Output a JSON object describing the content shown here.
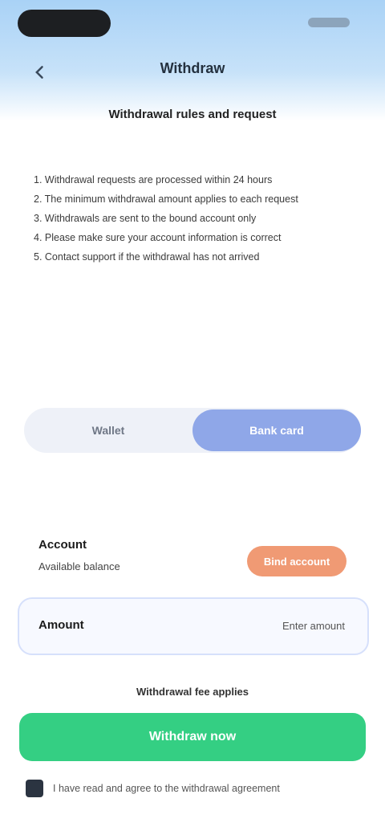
{
  "status_bar": {},
  "header": {
    "title": "Withdraw"
  },
  "intro": "Withdrawal rules and request",
  "rules": [
    "1. Withdrawal requests are processed within 24 hours",
    "2. The minimum withdrawal amount applies to each request",
    "3. Withdrawals are sent to the bound account only",
    "4. Please make sure your account information is correct",
    "5. Contact support if the withdrawal has not arrived"
  ],
  "toggle": {
    "left": "Wallet",
    "right": "Bank card"
  },
  "wallet": {
    "label": "Account",
    "sub": "Available balance",
    "button": "Bind account"
  },
  "amount": {
    "label": "Amount",
    "value": "Enter amount"
  },
  "hint": "Withdrawal fee applies",
  "submit": "Withdraw now",
  "agreement": "I have read and agree to the withdrawal agreement",
  "colors": {
    "header": "#a9d2f6",
    "accent": "#8fa7e8",
    "orange": "#f09a74",
    "green": "#34cf83"
  }
}
